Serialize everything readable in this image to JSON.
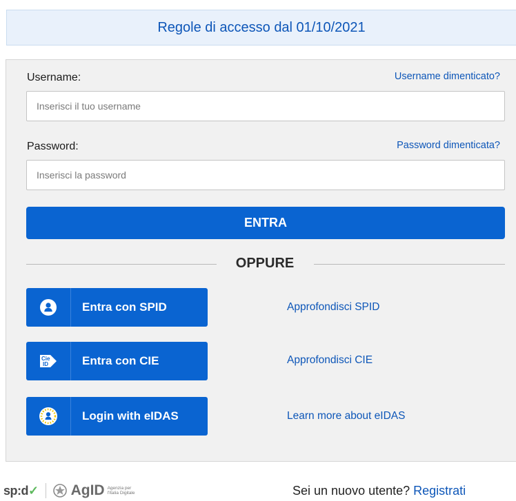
{
  "banner": {
    "text": "Regole di accesso dal 01/10/2021"
  },
  "login": {
    "username_label": "Username:",
    "username_forgot": "Username dimenticato?",
    "username_placeholder": "Inserisci il tuo username",
    "username_value": "",
    "password_label": "Password:",
    "password_forgot": "Password dimenticata?",
    "password_placeholder": "Inserisci la password",
    "password_value": "",
    "submit_label": "ENTRA"
  },
  "divider": {
    "text": "OPPURE"
  },
  "identity": [
    {
      "label": "Entra con SPID",
      "icon": "spid-user-icon",
      "more": "Approfondisci SPID"
    },
    {
      "label": "Entra con CIE",
      "icon": "cie-id-icon",
      "more": "Approfondisci CIE"
    },
    {
      "label": "Login with eIDAS",
      "icon": "eidas-stars-icon",
      "more": "Learn more about eIDAS"
    }
  ],
  "footer": {
    "spid_logo": "sp:d",
    "agid_logo": "AgID",
    "agid_subtitle_1": "Agenzia per",
    "agid_subtitle_2": "l'Italia Digitale",
    "new_user_text": "Sei un nuovo utente?",
    "register_link": "Registrati"
  },
  "colors": {
    "primary": "#0a64d1",
    "link": "#0d56b8",
    "panel_bg": "#f1f1f1",
    "banner_bg": "#e9f1fb"
  }
}
